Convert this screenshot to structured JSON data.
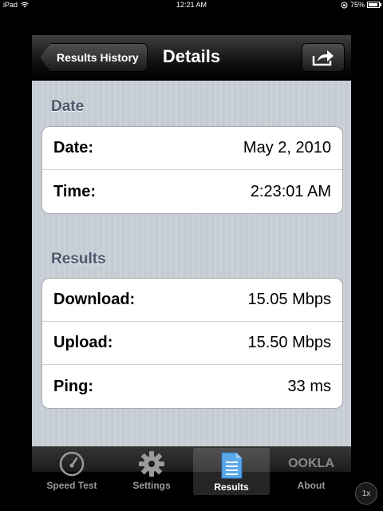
{
  "status_bar": {
    "device": "iPad",
    "time": "12:21 AM",
    "battery": "75%"
  },
  "navbar": {
    "back_label": "Results History",
    "title": "Details",
    "share_icon": "share-arrow-icon"
  },
  "sections": {
    "date": {
      "header": "Date",
      "rows": [
        {
          "label": "Date:",
          "value": "May 2, 2010"
        },
        {
          "label": "Time:",
          "value": "2:23:01 AM"
        }
      ]
    },
    "results": {
      "header": "Results",
      "rows": [
        {
          "label": "Download:",
          "value": "15.05 Mbps"
        },
        {
          "label": "Upload:",
          "value": "15.50 Mbps"
        },
        {
          "label": "Ping:",
          "value": "33 ms"
        }
      ]
    }
  },
  "tabbar": {
    "tabs": [
      {
        "label": "Speed Test",
        "icon": "speedometer-icon"
      },
      {
        "label": "Settings",
        "icon": "gear-icon"
      },
      {
        "label": "Results",
        "icon": "results-list-icon",
        "selected": true
      },
      {
        "label": "About",
        "icon": "ookla-logo",
        "logo_text": "OOKLA"
      }
    ]
  },
  "zoom_button": "1x",
  "colors": {
    "background": "#c5ccd4",
    "section_header": "#4c566c",
    "selected_tab": "#ffffff",
    "unselected_tab": "#9a9a9a"
  }
}
